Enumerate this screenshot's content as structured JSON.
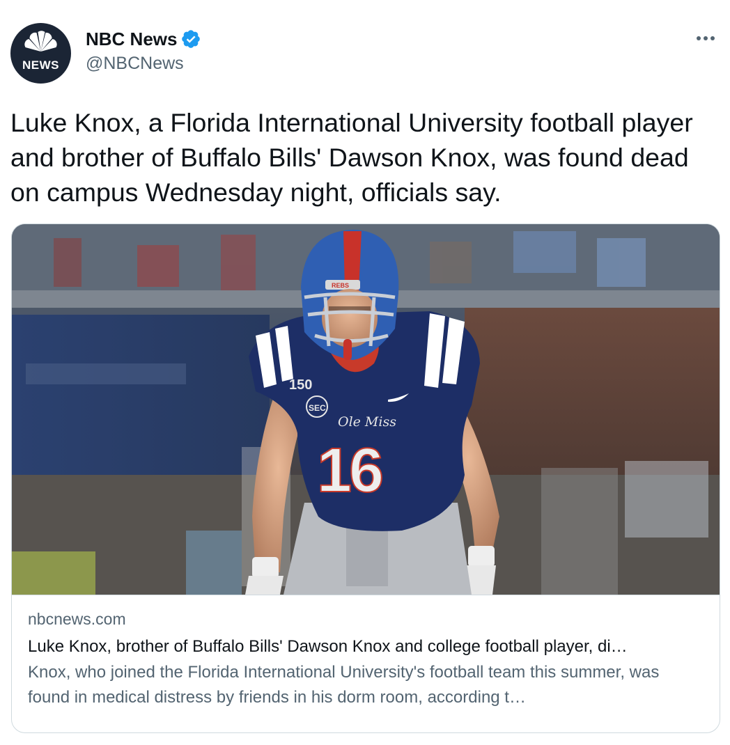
{
  "author": {
    "display_name": "NBC News",
    "handle": "@NBCNews",
    "avatar_text": "NEWS",
    "verified": true,
    "avatar_icon": "nbc-peacock-icon"
  },
  "tweet": {
    "text": "Luke Knox, a Florida International University football player and brother of Buffalo Bills' Dawson Knox, was found dead on campus Wednesday night, officials say."
  },
  "card": {
    "domain": "nbcnews.com",
    "title": "Luke Knox, brother of Buffalo Bills' Dawson Knox and college football player, di…",
    "description": "Knox, who joined the Florida International University's football team this summer, was found in medical distress by friends in his dorm room, according t…",
    "image": {
      "helmet_text": "REBS",
      "jersey_patch": "150",
      "jersey_logo": "SEC",
      "jersey_script": "Ole Miss",
      "jersey_number": "16"
    }
  },
  "colors": {
    "text_primary": "#0f1419",
    "text_secondary": "#536471",
    "verified_blue": "#1d9bf0",
    "border": "#cfd9de",
    "avatar_bg": "#1b2535"
  }
}
